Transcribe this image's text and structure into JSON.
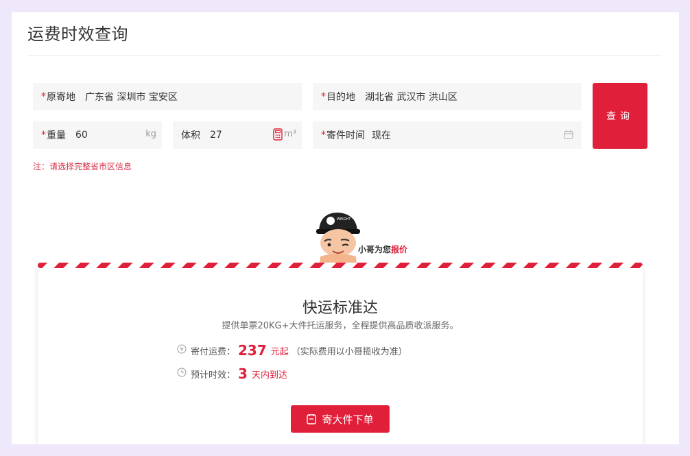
{
  "page": {
    "title": "运费时效查询"
  },
  "form": {
    "origin": {
      "label": "原寄地",
      "value": "广东省 深圳市 宝安区"
    },
    "destination": {
      "label": "目的地",
      "value": "湖北省 武汉市 洪山区"
    },
    "weight": {
      "label": "重量",
      "value": "60",
      "unit": "kg"
    },
    "volume": {
      "label": "体积",
      "value": "27",
      "unit": "m³"
    },
    "send_time": {
      "label": "寄件时间",
      "value": "现在"
    },
    "required_mark": "*",
    "query_button": "查询",
    "note": "注：请选择完整省市区信息"
  },
  "courier": {
    "text": "小哥为您",
    "highlight": "报价"
  },
  "result": {
    "title": "快运标准达",
    "description": "提供单票20KG+大件托运服务，全程提供高品质收派服务。",
    "fee_label": "寄付运费：",
    "fee_value": "237",
    "fee_unit": "元起",
    "fee_note": "（实际费用以小哥揽收为准）",
    "time_label": "预计时效：",
    "time_value": "3",
    "time_unit": "天内到达",
    "order_button": "寄大件下单"
  },
  "colors": {
    "accent": "#e0203a",
    "background": "#efe8fb",
    "field_bg": "#f6f6f6"
  }
}
